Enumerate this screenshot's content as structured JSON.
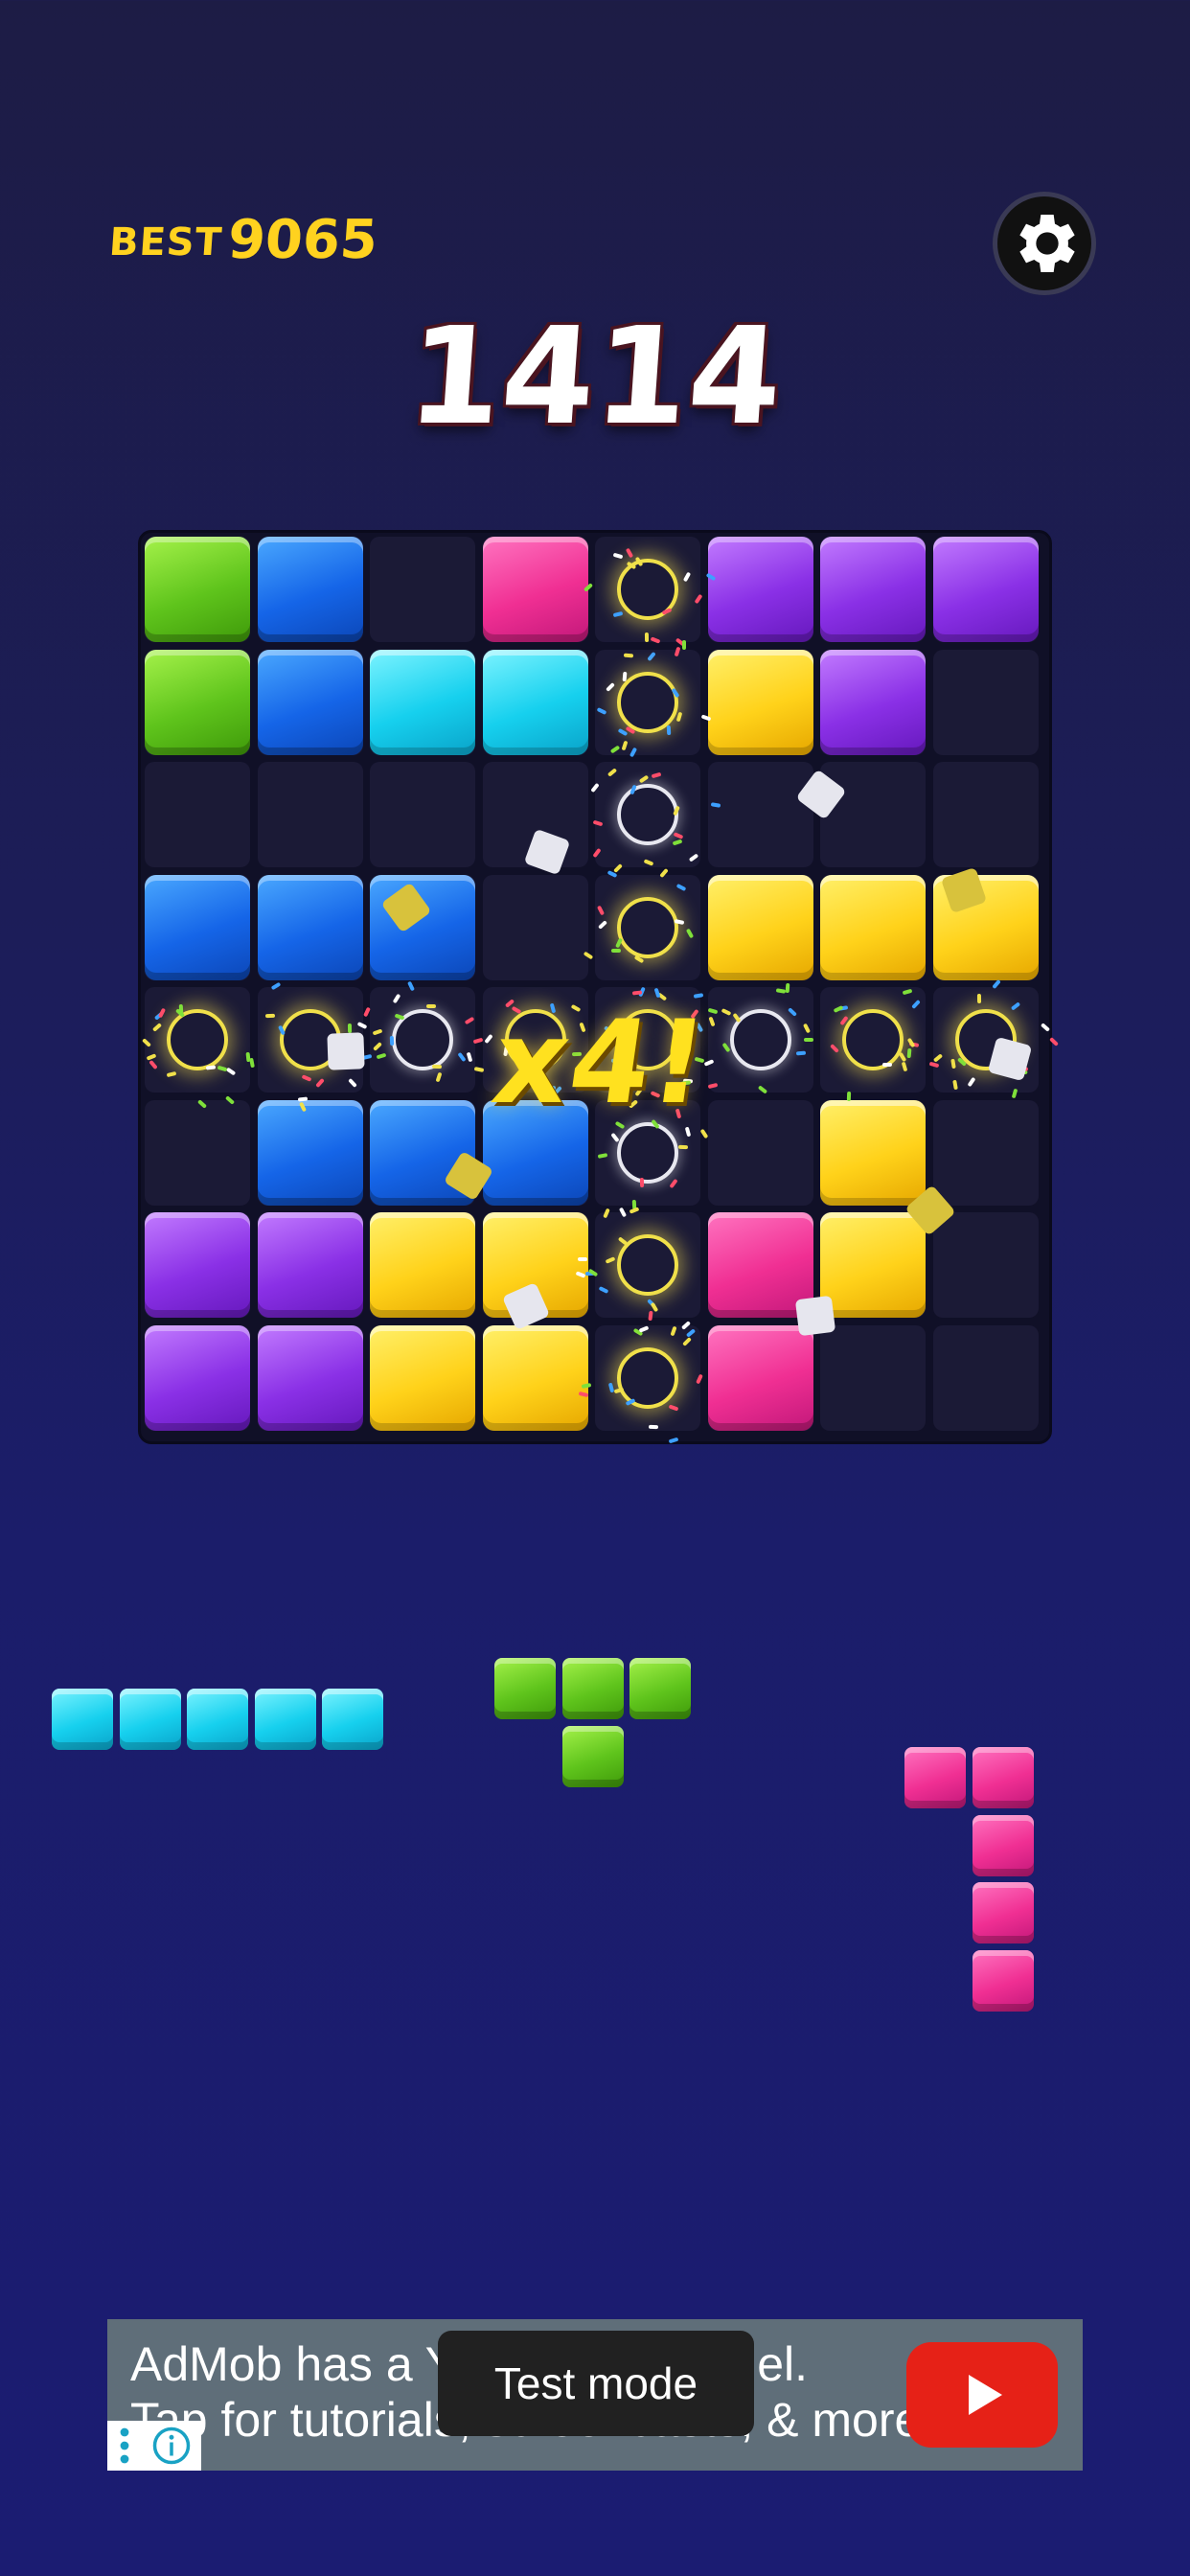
{
  "hud": {
    "best_label": "BEST",
    "best_score": "9065",
    "current_score": "1414",
    "settings_icon": "gear-icon"
  },
  "combo": {
    "text": "x4!"
  },
  "palette": {
    "green": "#5fc41c",
    "blue": "#1565e8",
    "pink": "#f02f93",
    "purple": "#8a30e6",
    "cyan": "#16d0ee",
    "yellow": "#ffd21a",
    "empty": "#1b1a36",
    "board_background": "#101027"
  },
  "board": {
    "rows": 8,
    "cols": 8,
    "grid": [
      [
        "green",
        "blue",
        "",
        "pink",
        "",
        "purple",
        "purple",
        "purple"
      ],
      [
        "green",
        "blue",
        "cyan",
        "cyan",
        "",
        "yellow",
        "purple",
        ""
      ],
      [
        "",
        "",
        "",
        "",
        "",
        "",
        "",
        ""
      ],
      [
        "blue",
        "blue",
        "blue",
        "",
        "",
        "yellow",
        "yellow",
        "yellow"
      ],
      [
        "",
        "",
        "",
        "",
        "",
        "",
        "",
        ""
      ],
      [
        "",
        "blue",
        "blue",
        "blue",
        "",
        "",
        "yellow",
        ""
      ],
      [
        "purple",
        "purple",
        "yellow",
        "yellow",
        "",
        "pink",
        "yellow",
        ""
      ],
      [
        "purple",
        "purple",
        "yellow",
        "yellow",
        "",
        "pink",
        "",
        ""
      ]
    ],
    "cleared_row": 4,
    "cleared_col": 4
  },
  "tray": [
    {
      "name": "piece-i5-cyan",
      "color": "cyan",
      "cells": [
        [
          0,
          0
        ],
        [
          0,
          1
        ],
        [
          0,
          2
        ],
        [
          0,
          3
        ],
        [
          0,
          4
        ]
      ]
    },
    {
      "name": "piece-t-green",
      "color": "green",
      "cells": [
        [
          0,
          0
        ],
        [
          0,
          1
        ],
        [
          0,
          2
        ],
        [
          1,
          1
        ]
      ]
    },
    {
      "name": "piece-j-pink",
      "color": "pink",
      "cells": [
        [
          0,
          0
        ],
        [
          0,
          1
        ],
        [
          1,
          1
        ],
        [
          2,
          1
        ],
        [
          3,
          1
        ]
      ]
    }
  ],
  "ad": {
    "line1": "AdMob has a YouTube channel.",
    "line2": "Tap for tutorials, screencasts, & more.",
    "play_icon": "play-icon",
    "info_icon": "info-icon",
    "toast": "Test mode"
  }
}
